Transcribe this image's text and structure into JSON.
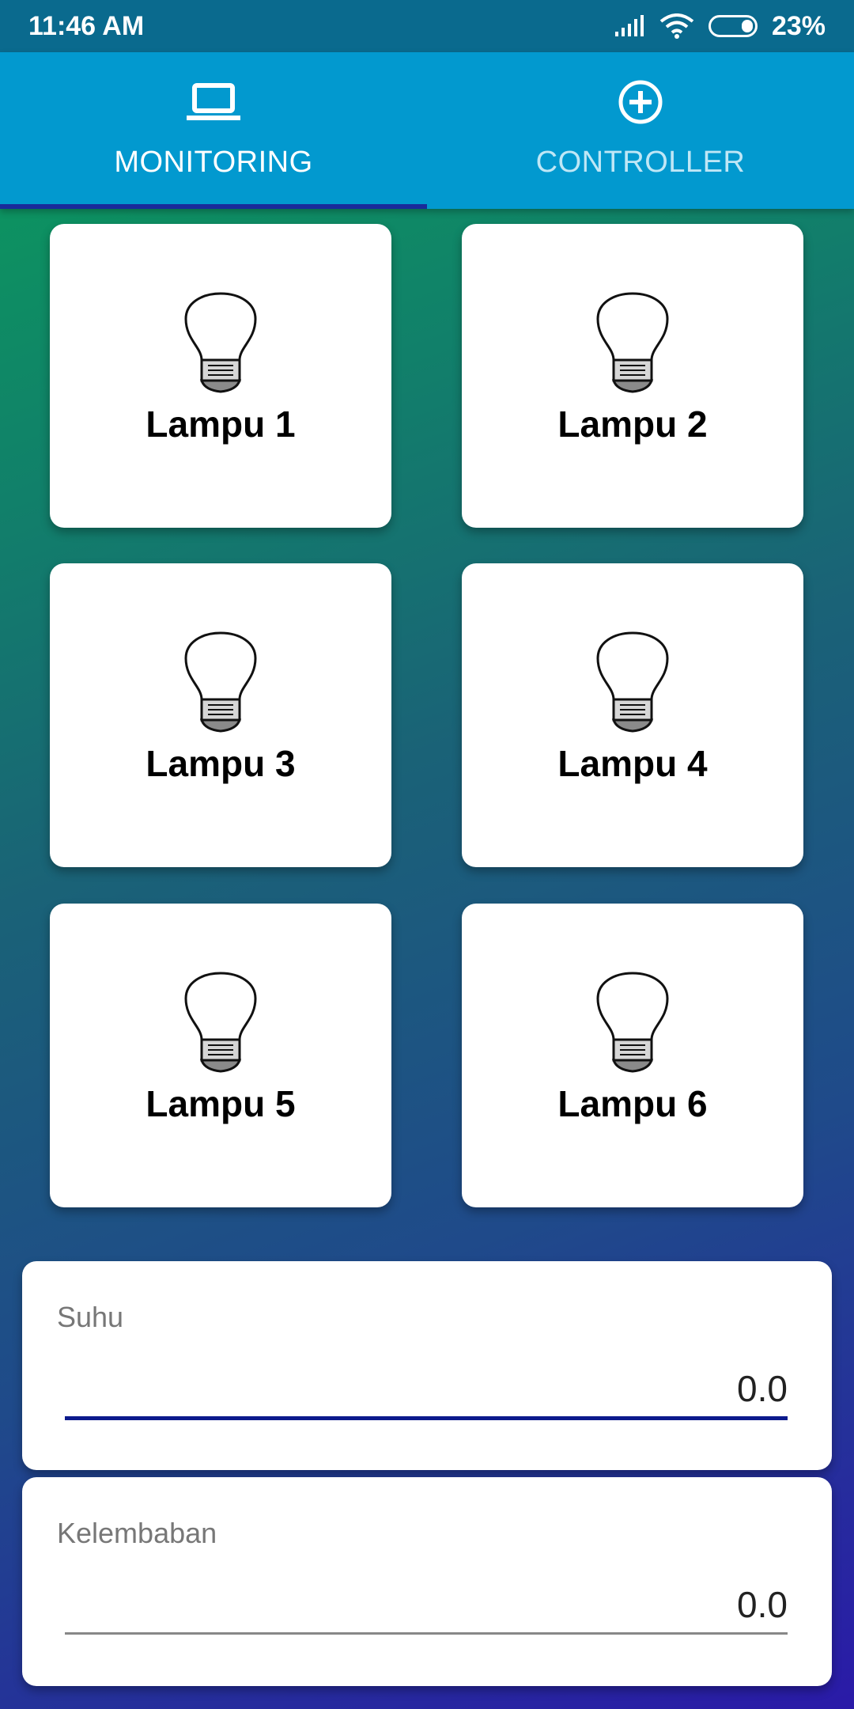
{
  "status_bar": {
    "time": "11:46 AM",
    "battery_percent": "23%",
    "icons": [
      "signal-icon",
      "wifi-icon",
      "battery-icon"
    ]
  },
  "tabs": [
    {
      "label": "MONITORING",
      "icon": "laptop-icon",
      "selected": true
    },
    {
      "label": "CONTROLLER",
      "icon": "plus-circle-icon",
      "selected": false
    }
  ],
  "lamps": [
    {
      "label": "Lampu 1",
      "icon": "lightbulb-icon"
    },
    {
      "label": "Lampu 2",
      "icon": "lightbulb-icon"
    },
    {
      "label": "Lampu 3",
      "icon": "lightbulb-icon"
    },
    {
      "label": "Lampu 4",
      "icon": "lightbulb-icon"
    },
    {
      "label": "Lampu 5",
      "icon": "lightbulb-icon"
    },
    {
      "label": "Lampu 6",
      "icon": "lightbulb-icon"
    }
  ],
  "sensors": {
    "suhu": {
      "label": "Suhu",
      "value": "0.0"
    },
    "kelembaban": {
      "label": "Kelembaban",
      "value": "0.0"
    }
  },
  "colors": {
    "status_bar": "#0a6a8e",
    "tab_bar": "#0299cf",
    "tab_indicator": "#1a2a9a",
    "gradient_top": "#0a9f5a",
    "gradient_bottom": "#2a1aa8"
  }
}
